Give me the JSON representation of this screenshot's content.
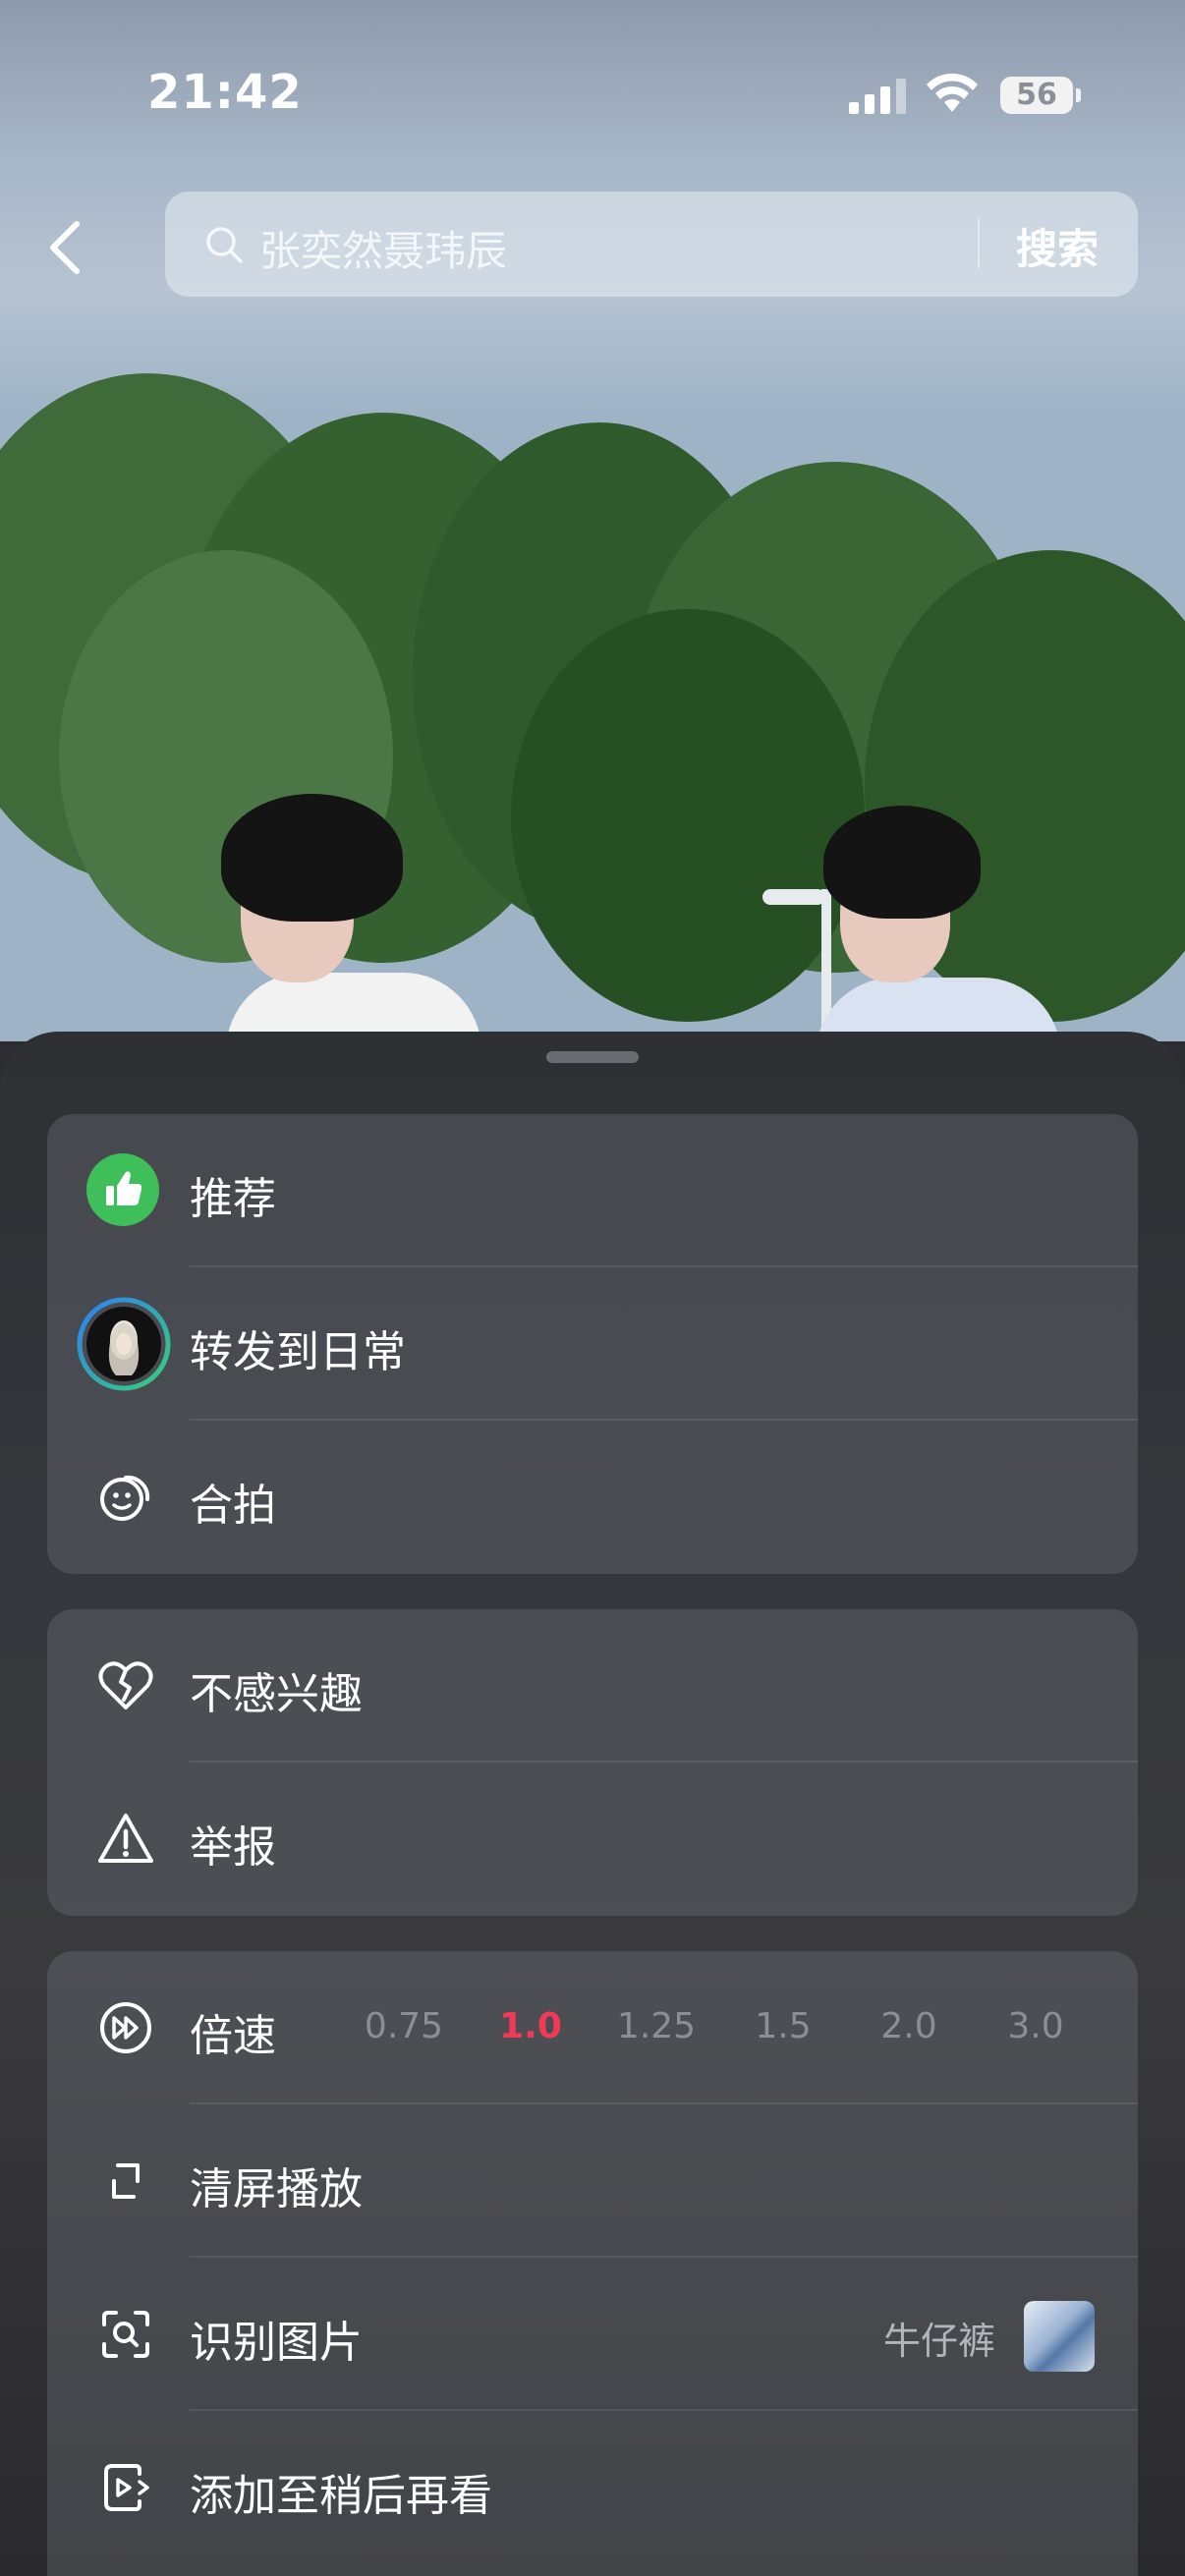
{
  "status_bar": {
    "time": "21:42",
    "battery": "56"
  },
  "search": {
    "placeholder": "张奕然聂玮辰",
    "button_label": "搜索"
  },
  "menu_group_1": [
    {
      "label": "推荐",
      "icon": "thumbs-up-icon"
    },
    {
      "label": "转发到日常",
      "icon": "avatar"
    },
    {
      "label": "合拍",
      "icon": "duet-icon"
    }
  ],
  "menu_group_2": [
    {
      "label": "不感兴趣",
      "icon": "broken-heart-icon"
    },
    {
      "label": "举报",
      "icon": "warning-icon"
    }
  ],
  "menu_group_3": {
    "speed": {
      "label": "倍速",
      "options": [
        "0.75",
        "1.0",
        "1.25",
        "1.5",
        "2.0",
        "3.0"
      ],
      "selected": "1.0"
    },
    "clear_screen": {
      "label": "清屏播放"
    },
    "recognize": {
      "label": "识别图片",
      "result": "牛仔裤"
    },
    "watch_later": {
      "label": "添加至稍后再看"
    }
  },
  "colors": {
    "accent_red": "#f23a56",
    "recommend_green": "#3fbf5a"
  }
}
